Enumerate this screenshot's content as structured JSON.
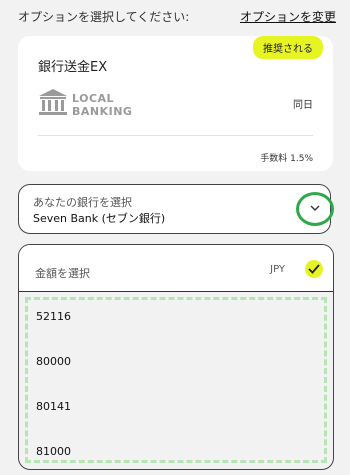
{
  "header": {
    "title": "オプションを選択してください:",
    "change_link": "オプションを変更"
  },
  "option_card": {
    "badge": "推奨される",
    "method": "銀行送金EX",
    "logo_line1": "LOCAL",
    "logo_line2": "BANKING",
    "timing": "同日",
    "fee": "手数料 1.5%"
  },
  "bank_select": {
    "label": "あなたの銀行を選択",
    "value": "Seven Bank (セブン銀行)"
  },
  "amount_select": {
    "label": "金額を選択",
    "currency": "JPY",
    "options": [
      "52116",
      "80000",
      "80141",
      "81000"
    ]
  },
  "colors": {
    "accent": "#e7f424",
    "highlight": "#2fa84a",
    "dashed_highlight": "#b7e4b5"
  }
}
